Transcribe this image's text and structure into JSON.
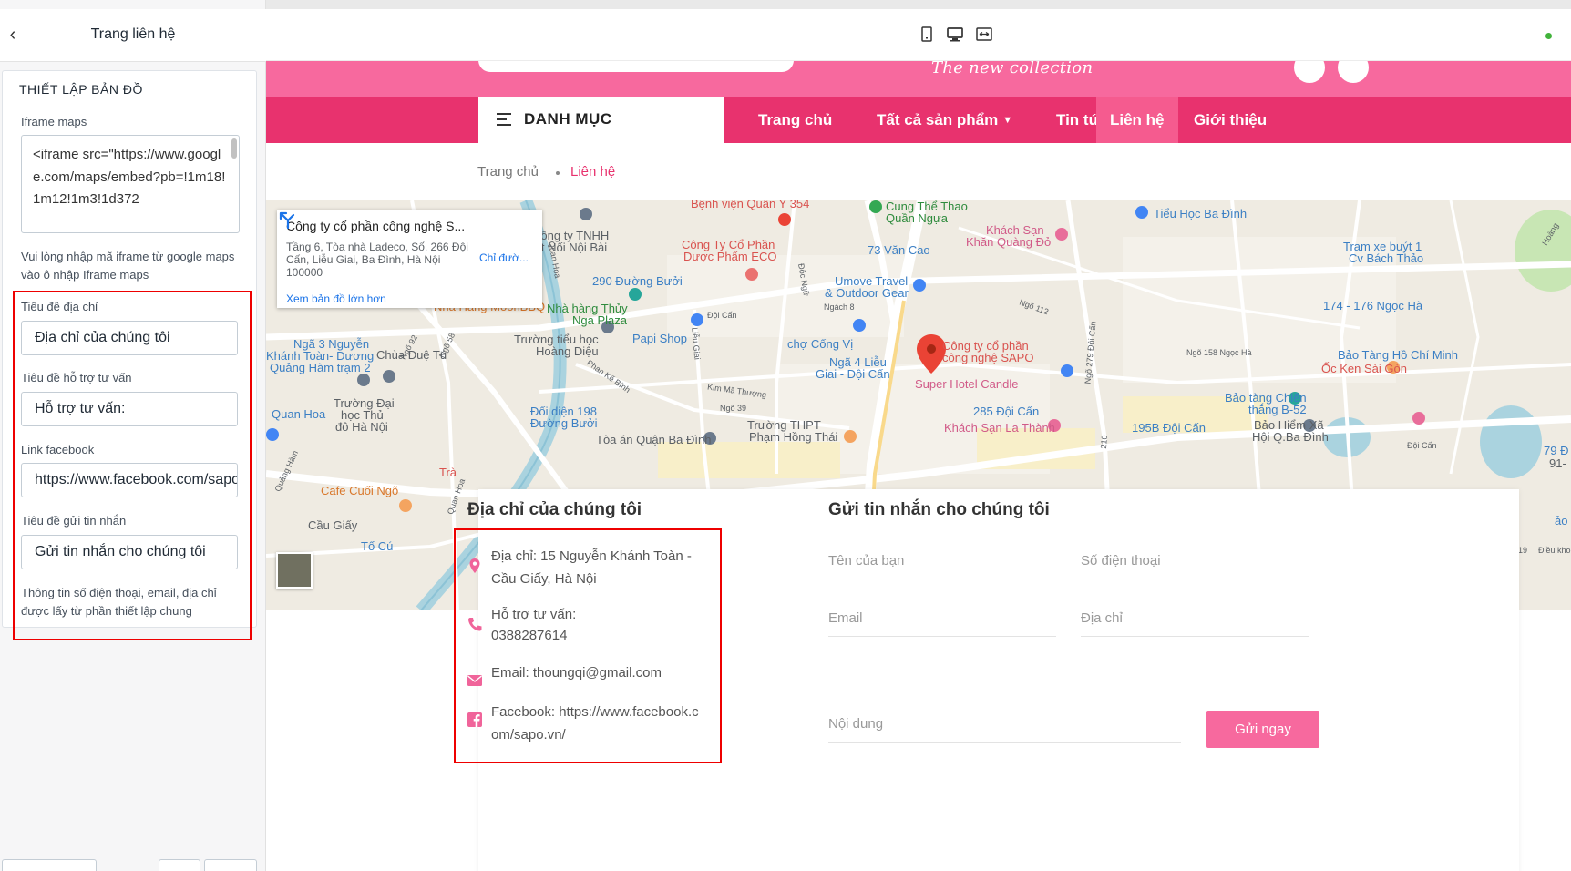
{
  "panel": {
    "title": "Trang liên hệ",
    "section_heading": "THIẾT LẬP BẢN ĐỒ",
    "iframe_label": "Iframe maps",
    "iframe_value": "<iframe src=\"https://www.google.com/maps/embed?pb=!1m18!1m12!1m3!1d372",
    "iframe_help": "Vui lòng nhập mã iframe từ google maps vào ô nhập Iframe maps",
    "address_title_label": "Tiêu đề địa chỉ",
    "address_title_value": "Địa chỉ của chúng tôi",
    "support_title_label": "Tiêu đề hỗ trợ tư vấn",
    "support_title_value": "Hỗ trợ tư vấn:",
    "facebook_label": "Link facebook",
    "facebook_value": "https://www.facebook.com/sapo.vn/",
    "message_title_label": "Tiêu đề gửi tin nhắn",
    "message_title_value": "Gửi tin nhắn cho chúng tôi",
    "note": "Thông tin số điện thoại, email, địa chỉ được lấy từ phần thiết lập chung"
  },
  "site": {
    "tagline": "The new collection",
    "category_label": "DANH MỤC",
    "nav": [
      {
        "label": "Trang chủ"
      },
      {
        "label": "Tất cả sản phẩm"
      },
      {
        "label": "Tin tức"
      },
      {
        "label": "Liên hệ"
      },
      {
        "label": "Giới thiệu"
      }
    ],
    "breadcrumb": {
      "home": "Trang chủ",
      "current": "Liên hệ"
    }
  },
  "map": {
    "info_title": "Công ty cổ phần công nghệ S...",
    "info_address": "Tầng 6, Tòa nhà Ladeco, Số, 266 Đội Cấn, Liễu Giai, Ba Đình, Hà Nội 100000",
    "info_link": "Xem bản đồ lớn hơn",
    "directions": "Chỉ đườ...",
    "labels": {
      "l1": "Bệnh viện Quân Y 354",
      "l2": "Cung Thể Thao",
      "l3": "Quần Ngựa",
      "l4": "Tiểu Học Ba Đình",
      "l5": "Công ty TNHH",
      "l6": "Kết Nối Nội Bài",
      "l7": "Công Ty Cổ Phần",
      "l8": "Dược Phẩm ECO",
      "l9": "73 Văn Cao",
      "l10": "Khách Sạn",
      "l11": "Khăn Quàng Đỏ",
      "l12": "Tram xe buýt 1",
      "l13": "Cv Bách Thảo",
      "l14": "290 Đường Bưởi",
      "l15": "Umove Travel",
      "l16": "& Outdoor Gear",
      "l17": "Nhà Hàng MoonBBQ",
      "l18": "Nhà hàng Thủy",
      "l19": "Nga Plaza",
      "l20": "174 - 176 Ngọc Hà",
      "l21": "Ngã 3 Nguyễn",
      "l22": "Khánh Toàn- Dương",
      "l23": "Quảng Hàm trạm 2",
      "l24": "Trường tiểu học",
      "l25": "Hoàng Diệu",
      "l26": "Papi Shop",
      "l27": "chợ Cống Vị",
      "l28": "Công ty cổ phần",
      "l29": "công nghệ SAPO",
      "l30": "Bảo Tàng Hồ Chí Minh",
      "l31": "Chùa Duệ Tú",
      "l32": "Ngã 4 Liễu",
      "l33": "Giai - Đội Cấn",
      "l34": "Super Hotel Candle",
      "l35": "Ốc Ken Sài Gòn",
      "l36": "Trường Đại",
      "l37": "học Thủ",
      "l38": "đô Hà Nội",
      "l39": "Quan Hoa",
      "l40": "Đối diện 198",
      "l41": "Đường Bưởi",
      "l42": "285 Đội Cấn",
      "l43": "Khách Sạn La Thành",
      "l44": "Bảo tàng Chiến",
      "l45": "thắng B-52",
      "l46": "Bảo Hiểm Xã",
      "l47": "Hội Q.Ba Đình",
      "l48": "195B Đội Cấn",
      "l49": "Trường THPT",
      "l50": "Phạm Hồng Thái",
      "l51": "Tòa án Quận Ba Đình",
      "l52": "Cafe Cuối Ngõ",
      "l53": "Cầu Giấy",
      "l54": "Tố Cú",
      "l55": "Trà",
      "l56": "79 Đ",
      "l57": "91-",
      "l58": "ảo",
      "l59": "Điều kho",
      "l60": "19"
    },
    "streets": {
      "s1": "Quan Hoa",
      "s2": "Ngõ 92",
      "s3": "Ngõ 58",
      "s4": "Đốc Ngữ",
      "s5": "Ngách 8",
      "s6": "Ngõ 112",
      "s7": "Đội Cấn",
      "s8": "Liễu Giai",
      "s9": "Phan Kế Bính",
      "s10": "Kim Mã Thượng",
      "s11": "Ngõ 39",
      "s12": "Ngõ 158 Ngọc Hà",
      "s13": "Ngõ 279 Đội Cấn",
      "s14": "Quảng Hàm",
      "s15": "Quan Hoa",
      "s16": "210",
      "s17": "Đội Cấn",
      "s18": "Hoàng"
    }
  },
  "contact": {
    "address_title": "Địa chỉ của chúng tôi",
    "address": "Địa chỉ: 15 Nguyễn Khánh Toàn - Cầu Giấy, Hà Nội",
    "support_label": "Hỗ trợ tư vấn:",
    "phone": "0388287614",
    "email": "Email: thoungqi@gmail.com",
    "facebook": "Facebook: https://www.facebook.com/sapo.vn/",
    "form_title": "Gửi tin nhắn cho chúng tôi",
    "name_placeholder": "Tên của bạn",
    "phone_placeholder": "Số điện thoại",
    "email_placeholder": "Email",
    "addr_placeholder": "Địa chỉ",
    "content_placeholder": "Nội dung",
    "send": "Gửi ngay"
  },
  "colors": {
    "pink_nav": "#e8326e",
    "pink_light": "#f7699e",
    "annotation_red": "#ee0000",
    "map_bg": "#efebe2"
  }
}
